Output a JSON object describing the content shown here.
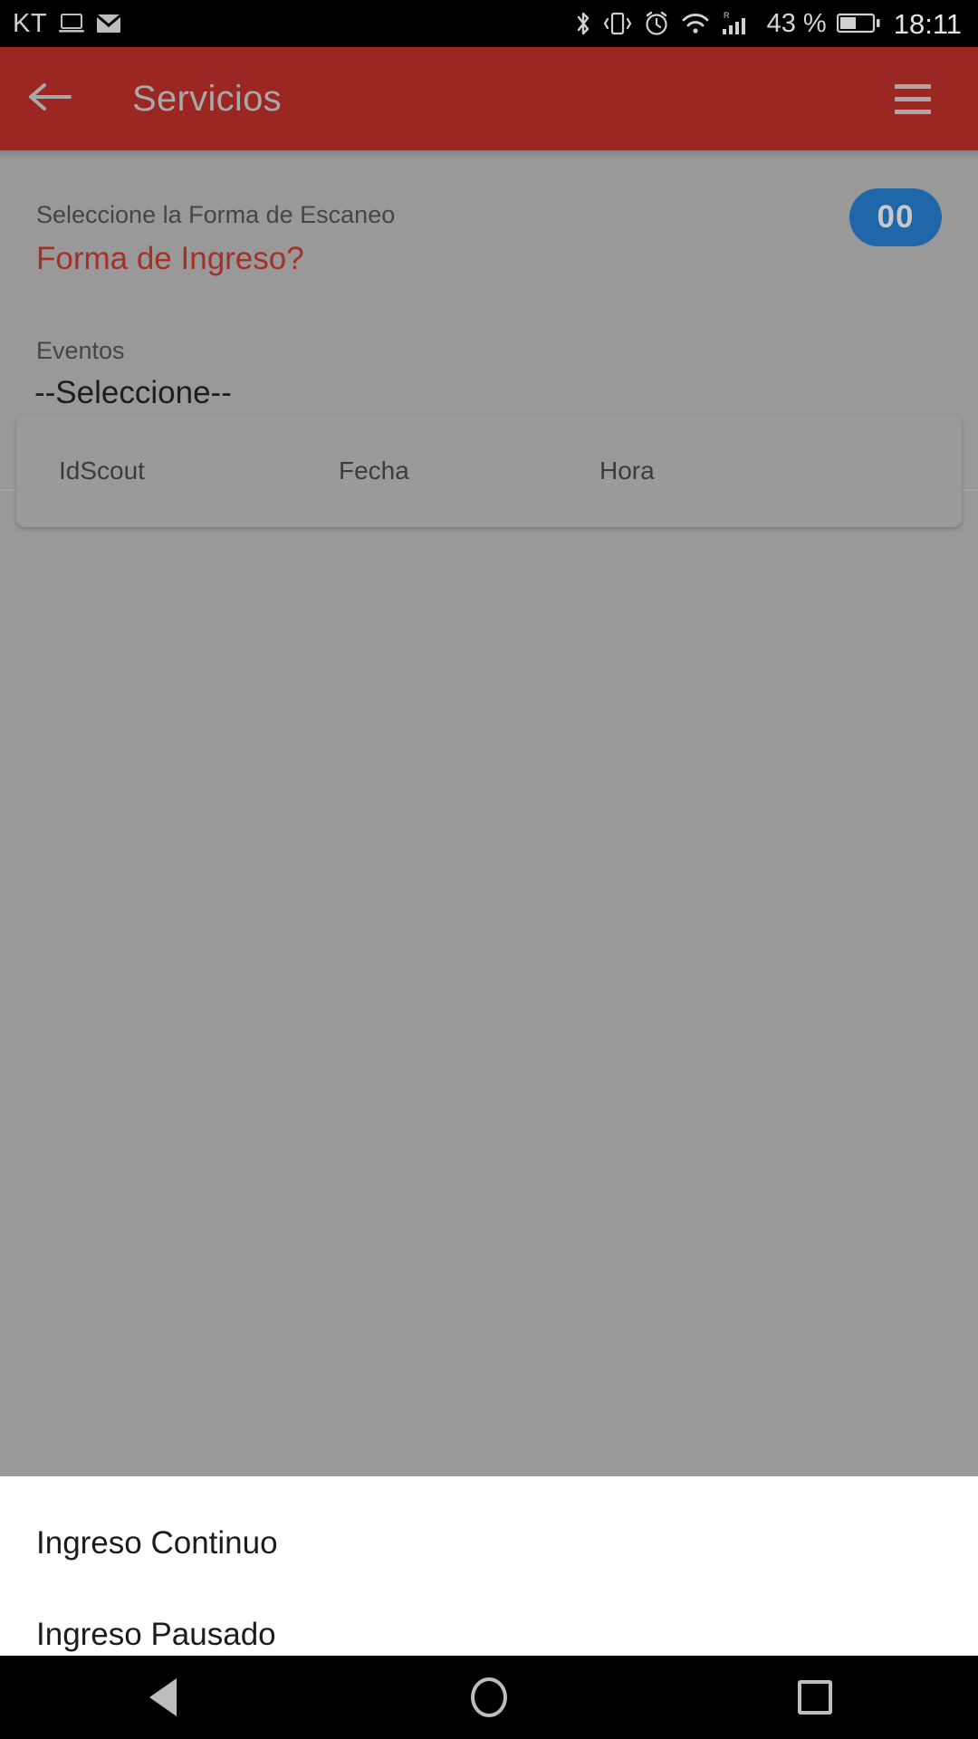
{
  "status_bar": {
    "carrier": "KT",
    "left_icons": [
      "laptop-cast-icon",
      "gmail-icon"
    ],
    "right_icons": [
      "bluetooth-icon",
      "vibrate-icon",
      "alarm-icon",
      "wifi-icon",
      "cell-signal-roaming-icon"
    ],
    "battery_percent": "43 %",
    "clock": "18:11"
  },
  "app_bar": {
    "back_icon": "arrow-left-icon",
    "title": "Servicios",
    "menu_icon": "hamburger-menu-icon",
    "background_color": "#9a2722"
  },
  "form": {
    "scan_mode_label": "Seleccione la Forma de Escaneo",
    "scan_mode_value": "Forma de Ingreso?",
    "scan_mode_value_color": "#a33129",
    "counter_badge": "00",
    "counter_badge_color": "#1f67a8",
    "events_label": "Eventos",
    "events_value": "--Seleccione--"
  },
  "table": {
    "columns": [
      "IdScout",
      "Fecha",
      "Hora"
    ],
    "rows": []
  },
  "dialog": {
    "options": [
      "Ingreso Continuo",
      "Ingreso Pausado"
    ]
  },
  "nav_bar": {
    "back": "nav-back-icon",
    "home": "nav-home-icon",
    "recents": "nav-recents-icon"
  }
}
